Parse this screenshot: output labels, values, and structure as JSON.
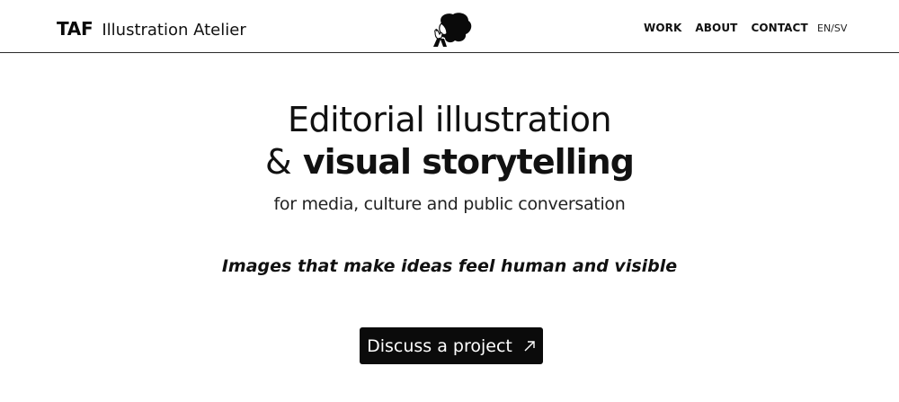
{
  "header": {
    "brand_mark": "TAF",
    "brand_name": "Illustration Atelier",
    "logo_icon": "illustrated-portrait-logo-icon",
    "nav": [
      {
        "label": "WORK"
      },
      {
        "label": "ABOUT"
      },
      {
        "label": "CONTACT"
      }
    ],
    "language_toggle": "EN/SV"
  },
  "hero": {
    "headline_line1": "Editorial illustration",
    "headline_amp": "&",
    "headline_bold": "visual storytelling",
    "subline": "for media, culture and public conversation"
  },
  "tagline": "Images that make ideas feel human and visible",
  "cta": {
    "label": "Discuss a project",
    "icon": "arrow-up-right-icon"
  },
  "colors": {
    "background": "#ffffff",
    "text": "#111111",
    "button_background": "#0b0b0b",
    "button_text": "#ffffff",
    "divider": "#2a2a2a"
  }
}
